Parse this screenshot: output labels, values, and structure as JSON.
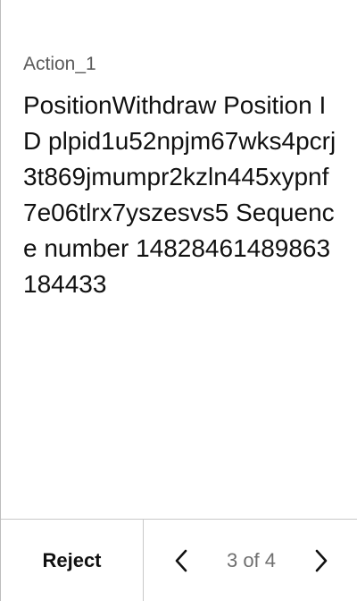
{
  "action": {
    "label": "Action_1",
    "message": "PositionWithdraw Position ID plpid1u52npjm67wks4pcrj3t869jmumpr2kzln445xypnf7e06tlrx7yszesvs5 Sequence number 14828461489863184433"
  },
  "footer": {
    "reject_label": "Reject",
    "counter": "3 of 4",
    "prev_icon": "chevron-left-icon",
    "next_icon": "chevron-right-icon"
  }
}
